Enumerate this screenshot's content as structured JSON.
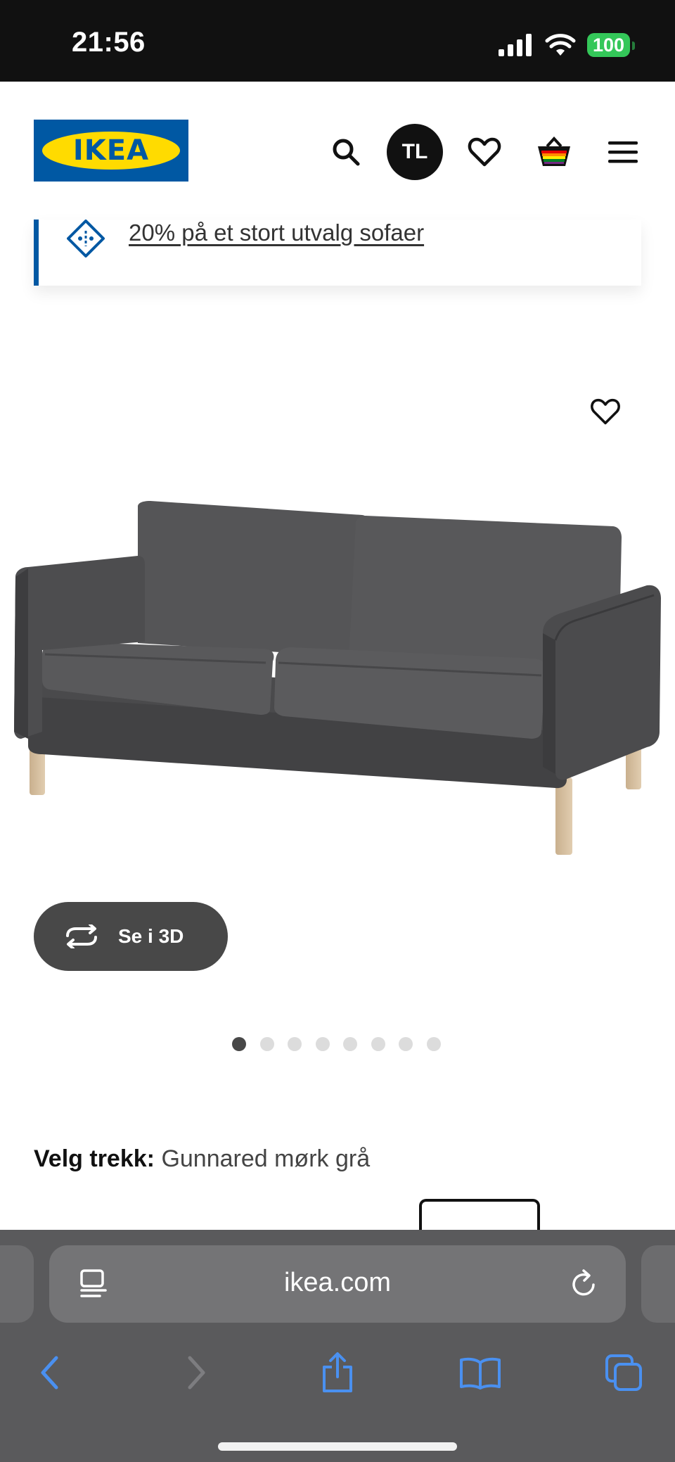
{
  "status_bar": {
    "time": "21:56",
    "battery": "100"
  },
  "header": {
    "logo_text": "IKEA",
    "avatar_initials": "TL"
  },
  "promo": {
    "text": "20% på et stort utvalg sofaer"
  },
  "product": {
    "view_3d_label": "Se i 3D",
    "image_count": 8,
    "active_image_index": 0,
    "cover_label": "Velg trekk:",
    "cover_value": "Gunnared mørk grå"
  },
  "browser": {
    "url": "ikea.com"
  },
  "colors": {
    "ikea_blue": "#0058a3",
    "ikea_yellow": "#ffdb00",
    "button_dark": "#484848",
    "safari_accent": "#4a90f0"
  }
}
